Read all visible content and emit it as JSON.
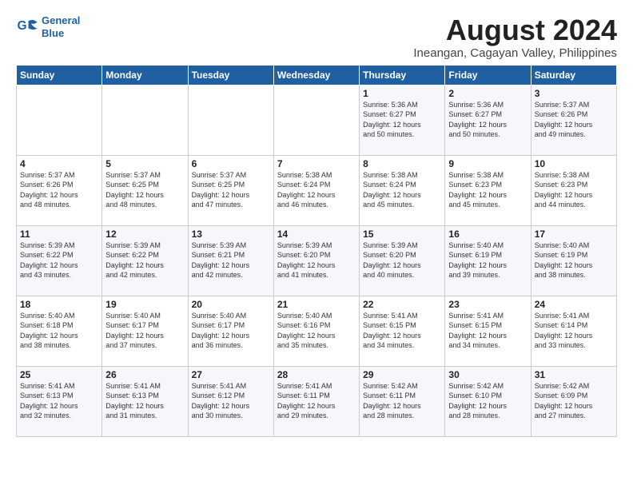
{
  "logo": {
    "line1": "General",
    "line2": "Blue"
  },
  "title": "August 2024",
  "location": "Ineangan, Cagayan Valley, Philippines",
  "header_days": [
    "Sunday",
    "Monday",
    "Tuesday",
    "Wednesday",
    "Thursday",
    "Friday",
    "Saturday"
  ],
  "weeks": [
    [
      {
        "day": "",
        "info": ""
      },
      {
        "day": "",
        "info": ""
      },
      {
        "day": "",
        "info": ""
      },
      {
        "day": "",
        "info": ""
      },
      {
        "day": "1",
        "info": "Sunrise: 5:36 AM\nSunset: 6:27 PM\nDaylight: 12 hours\nand 50 minutes."
      },
      {
        "day": "2",
        "info": "Sunrise: 5:36 AM\nSunset: 6:27 PM\nDaylight: 12 hours\nand 50 minutes."
      },
      {
        "day": "3",
        "info": "Sunrise: 5:37 AM\nSunset: 6:26 PM\nDaylight: 12 hours\nand 49 minutes."
      }
    ],
    [
      {
        "day": "4",
        "info": "Sunrise: 5:37 AM\nSunset: 6:26 PM\nDaylight: 12 hours\nand 48 minutes."
      },
      {
        "day": "5",
        "info": "Sunrise: 5:37 AM\nSunset: 6:25 PM\nDaylight: 12 hours\nand 48 minutes."
      },
      {
        "day": "6",
        "info": "Sunrise: 5:37 AM\nSunset: 6:25 PM\nDaylight: 12 hours\nand 47 minutes."
      },
      {
        "day": "7",
        "info": "Sunrise: 5:38 AM\nSunset: 6:24 PM\nDaylight: 12 hours\nand 46 minutes."
      },
      {
        "day": "8",
        "info": "Sunrise: 5:38 AM\nSunset: 6:24 PM\nDaylight: 12 hours\nand 45 minutes."
      },
      {
        "day": "9",
        "info": "Sunrise: 5:38 AM\nSunset: 6:23 PM\nDaylight: 12 hours\nand 45 minutes."
      },
      {
        "day": "10",
        "info": "Sunrise: 5:38 AM\nSunset: 6:23 PM\nDaylight: 12 hours\nand 44 minutes."
      }
    ],
    [
      {
        "day": "11",
        "info": "Sunrise: 5:39 AM\nSunset: 6:22 PM\nDaylight: 12 hours\nand 43 minutes."
      },
      {
        "day": "12",
        "info": "Sunrise: 5:39 AM\nSunset: 6:22 PM\nDaylight: 12 hours\nand 42 minutes."
      },
      {
        "day": "13",
        "info": "Sunrise: 5:39 AM\nSunset: 6:21 PM\nDaylight: 12 hours\nand 42 minutes."
      },
      {
        "day": "14",
        "info": "Sunrise: 5:39 AM\nSunset: 6:20 PM\nDaylight: 12 hours\nand 41 minutes."
      },
      {
        "day": "15",
        "info": "Sunrise: 5:39 AM\nSunset: 6:20 PM\nDaylight: 12 hours\nand 40 minutes."
      },
      {
        "day": "16",
        "info": "Sunrise: 5:40 AM\nSunset: 6:19 PM\nDaylight: 12 hours\nand 39 minutes."
      },
      {
        "day": "17",
        "info": "Sunrise: 5:40 AM\nSunset: 6:19 PM\nDaylight: 12 hours\nand 38 minutes."
      }
    ],
    [
      {
        "day": "18",
        "info": "Sunrise: 5:40 AM\nSunset: 6:18 PM\nDaylight: 12 hours\nand 38 minutes."
      },
      {
        "day": "19",
        "info": "Sunrise: 5:40 AM\nSunset: 6:17 PM\nDaylight: 12 hours\nand 37 minutes."
      },
      {
        "day": "20",
        "info": "Sunrise: 5:40 AM\nSunset: 6:17 PM\nDaylight: 12 hours\nand 36 minutes."
      },
      {
        "day": "21",
        "info": "Sunrise: 5:40 AM\nSunset: 6:16 PM\nDaylight: 12 hours\nand 35 minutes."
      },
      {
        "day": "22",
        "info": "Sunrise: 5:41 AM\nSunset: 6:15 PM\nDaylight: 12 hours\nand 34 minutes."
      },
      {
        "day": "23",
        "info": "Sunrise: 5:41 AM\nSunset: 6:15 PM\nDaylight: 12 hours\nand 34 minutes."
      },
      {
        "day": "24",
        "info": "Sunrise: 5:41 AM\nSunset: 6:14 PM\nDaylight: 12 hours\nand 33 minutes."
      }
    ],
    [
      {
        "day": "25",
        "info": "Sunrise: 5:41 AM\nSunset: 6:13 PM\nDaylight: 12 hours\nand 32 minutes."
      },
      {
        "day": "26",
        "info": "Sunrise: 5:41 AM\nSunset: 6:13 PM\nDaylight: 12 hours\nand 31 minutes."
      },
      {
        "day": "27",
        "info": "Sunrise: 5:41 AM\nSunset: 6:12 PM\nDaylight: 12 hours\nand 30 minutes."
      },
      {
        "day": "28",
        "info": "Sunrise: 5:41 AM\nSunset: 6:11 PM\nDaylight: 12 hours\nand 29 minutes."
      },
      {
        "day": "29",
        "info": "Sunrise: 5:42 AM\nSunset: 6:11 PM\nDaylight: 12 hours\nand 28 minutes."
      },
      {
        "day": "30",
        "info": "Sunrise: 5:42 AM\nSunset: 6:10 PM\nDaylight: 12 hours\nand 28 minutes."
      },
      {
        "day": "31",
        "info": "Sunrise: 5:42 AM\nSunset: 6:09 PM\nDaylight: 12 hours\nand 27 minutes."
      }
    ]
  ]
}
